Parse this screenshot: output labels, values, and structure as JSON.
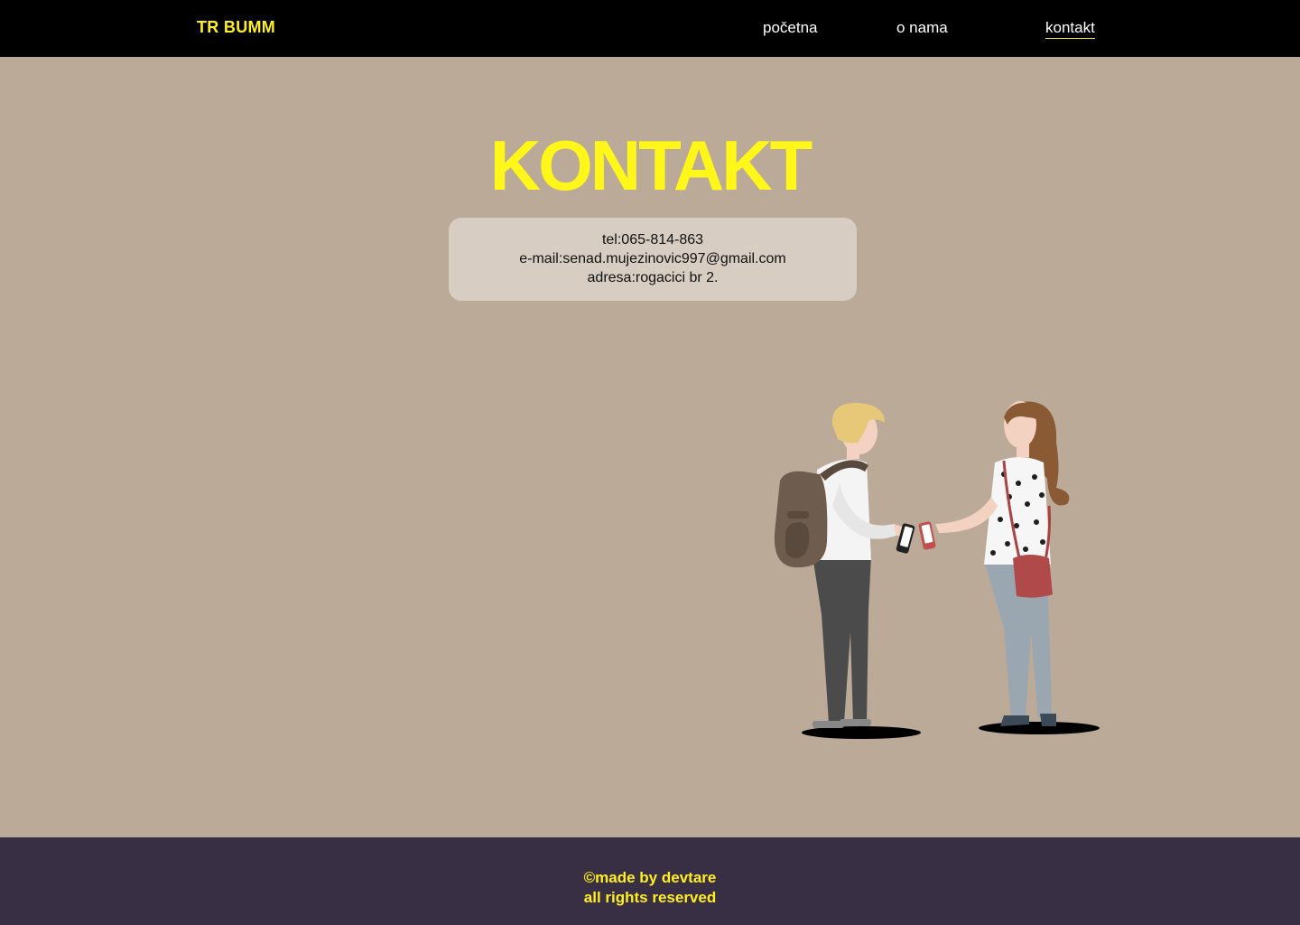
{
  "nav": {
    "brand": "TR BUMM",
    "links": [
      {
        "label": "početna"
      },
      {
        "label": "o nama"
      },
      {
        "label": "kontakt",
        "active": true
      }
    ]
  },
  "main": {
    "title": "KONTAKT",
    "contact": {
      "phone": "tel:065-814-863",
      "email": "e-mail:senad.mujezinovic997@gmail.com",
      "address": "adresa:rogacici br 2."
    }
  },
  "footer": {
    "line1": "©made by devtare",
    "line2": "all rights reserved"
  },
  "colors": {
    "background": "#bbaa98",
    "navbar": "#000000",
    "accent_yellow": "#fff71a",
    "card": "#d7cdc2",
    "footer": "#392f44"
  }
}
